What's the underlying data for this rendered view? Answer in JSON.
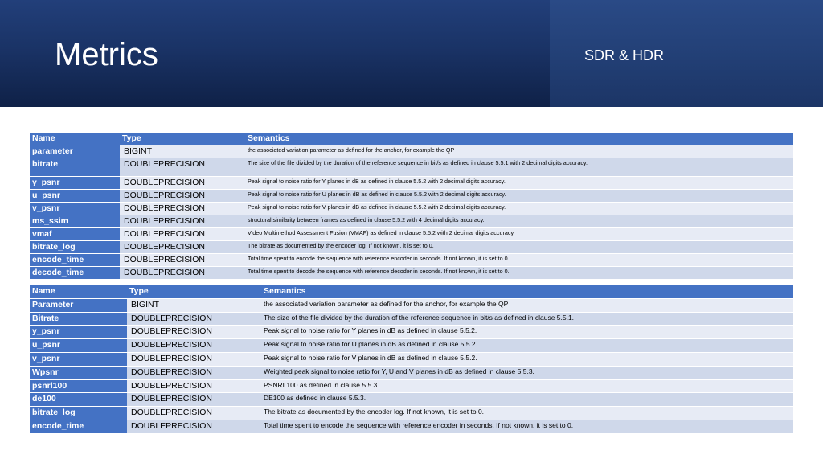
{
  "header": {
    "title": "Metrics",
    "subtitle": "SDR & HDR"
  },
  "colors": {
    "banner": "#1a3366",
    "table_header": "#4472c4",
    "row_light": "#e7ebf5",
    "row_dark": "#cfd8ea"
  },
  "table1": {
    "columns": [
      "Name",
      "Type",
      "Semantics"
    ],
    "rows": [
      [
        "parameter",
        "BIGINT",
        "the associated variation parameter as defined for the anchor, for example the QP"
      ],
      [
        "bitrate",
        "DOUBLEPRECISION",
        "The size of the file divided by the duration of the reference sequence in bit/s as defined in clause 5.5.1 with 2 decimal digits accuracy."
      ],
      [
        "y_psnr",
        "DOUBLEPRECISION",
        "Peak signal to noise ratio for Y planes in dB as defined in clause 5.5.2 with 2 decimal digits accuracy."
      ],
      [
        "u_psnr",
        "DOUBLEPRECISION",
        "Peak signal to noise ratio for U planes in dB as defined in clause 5.5.2 with 2 decimal digits accuracy."
      ],
      [
        "v_psnr",
        "DOUBLEPRECISION",
        "Peak signal to noise ratio for V planes in dB as defined in clause 5.5.2 with 2 decimal digits accuracy."
      ],
      [
        "ms_ssim",
        "DOUBLEPRECISION",
        "structural similarity between frames as defined in clause 5.5.2 with 4 decimal digits accuracy."
      ],
      [
        "vmaf",
        "DOUBLEPRECISION",
        "Video Multimethod Assessment Fusion (VMAF) as defined in clause 5.5.2 with 2 decimal digits accuracy."
      ],
      [
        "bitrate_log",
        "DOUBLEPRECISION",
        "The bitrate as documented by the encoder log. If not known, it is set to 0."
      ],
      [
        "encode_time",
        "DOUBLEPRECISION",
        "Total time spent to encode the sequence with reference encoder in seconds. If not known, it is set to 0."
      ],
      [
        "decode_time",
        "DOUBLEPRECISION",
        "Total time spent to decode the sequence with reference decoder in seconds. If not known, it is set to 0."
      ]
    ]
  },
  "table2": {
    "columns": [
      "Name",
      "Type",
      "Semantics"
    ],
    "rows": [
      [
        "Parameter",
        "BIGINT",
        "the associated variation parameter as defined for the anchor, for example the QP"
      ],
      [
        "Bitrate",
        "DOUBLEPRECISION",
        "The size of the file divided by the duration of the reference sequence in bit/s as defined in clause 5.5.1."
      ],
      [
        "y_psnr",
        "DOUBLEPRECISION",
        "Peak signal to noise ratio for Y planes in dB as defined in clause 5.5.2."
      ],
      [
        "u_psnr",
        "DOUBLEPRECISION",
        "Peak signal to noise ratio for U planes in dB as defined in clause 5.5.2."
      ],
      [
        "v_psnr",
        "DOUBLEPRECISION",
        "Peak signal to noise ratio for V planes in dB as defined in clause 5.5.2."
      ],
      [
        "Wpsnr",
        "DOUBLEPRECISION",
        "Weighted peak signal to noise ratio for Y, U and V planes in dB as defined in clause 5.5.3."
      ],
      [
        "psnrl100",
        "DOUBLEPRECISION",
        "PSNRL100 as defined in clause 5.5.3"
      ],
      [
        "de100",
        "DOUBLEPRECISION",
        "DE100 as defined in clause 5.5.3."
      ],
      [
        "bitrate_log",
        "DOUBLEPRECISION",
        "The bitrate as documented by the encoder log. If not known, it is set to 0."
      ],
      [
        "encode_time",
        "DOUBLEPRECISION",
        "Total time spent to encode the sequence with reference encoder in seconds. If not known, it is set to 0."
      ]
    ]
  }
}
